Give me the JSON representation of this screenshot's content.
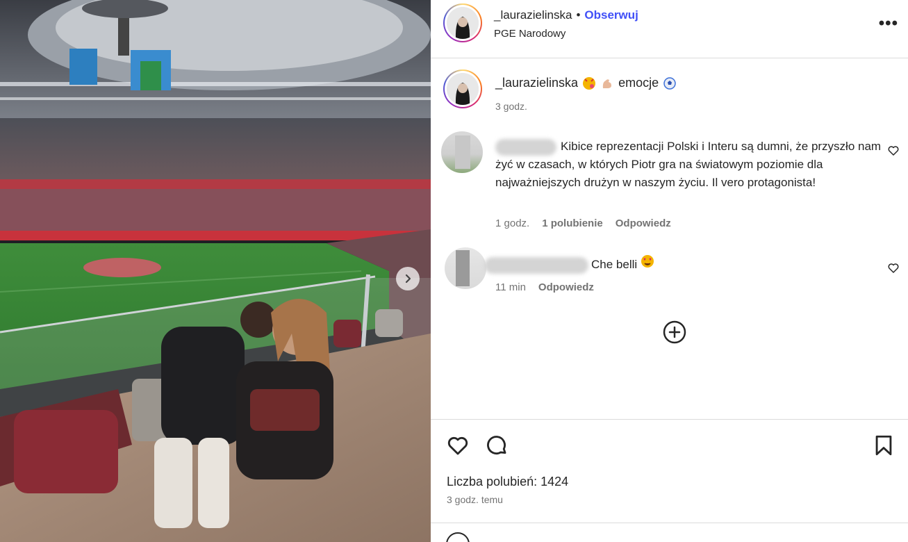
{
  "header": {
    "username": "_laurazielinska",
    "separator": "•",
    "follow_label": "Obserwuj",
    "location": "PGE Narodowy",
    "more_label": "•••"
  },
  "caption": {
    "username": "_laurazielinska",
    "text": "emocje",
    "emojis": [
      "kiss-face-emoji",
      "flexed-biceps-emoji",
      "soccer-ball-emoji"
    ],
    "time": "3 godz."
  },
  "comments": [
    {
      "text": "Kibice reprezentacji Polski i Interu są dumni, że przyszło nam żyć w czasach, w których Piotr gra na światowym poziomie dla najważniejszych drużyn w naszym życiu. Il vero protagonista!",
      "time": "1 godz.",
      "likes": "1 polubienie",
      "reply": "Odpowiedz"
    },
    {
      "text": "Che belli",
      "emoji": "heart-eyes-emoji",
      "time": "11 min",
      "reply": "Odpowiedz"
    }
  ],
  "post": {
    "likes": "Liczba polubień: 1424",
    "time": "3 godz. temu"
  },
  "colors": {
    "follow": "#4150f7",
    "text": "#262626",
    "muted": "#737373",
    "divider": "#dbdbdb"
  },
  "icons": [
    "chevron-right-icon",
    "more-icon",
    "heart-icon",
    "comment-icon",
    "bookmark-icon",
    "plus-circle-icon"
  ]
}
